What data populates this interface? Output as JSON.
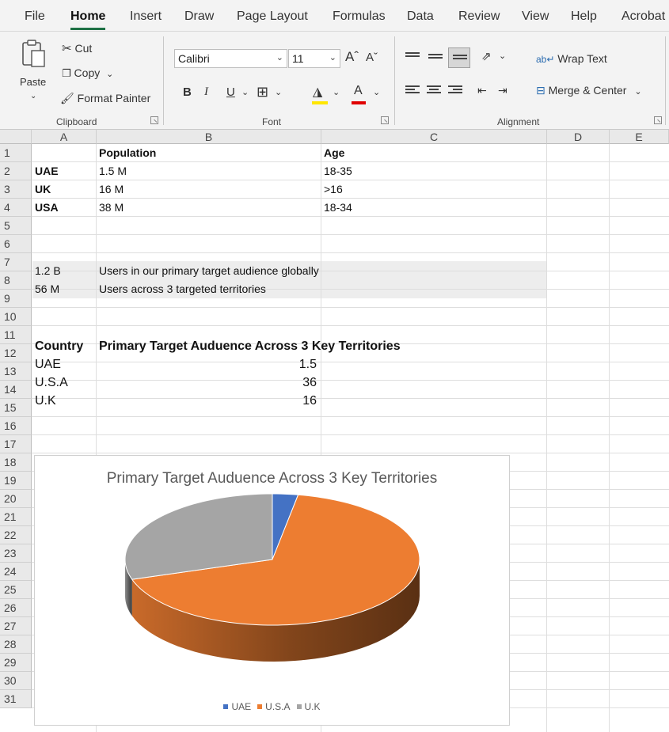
{
  "ribbon": {
    "tabs": [
      "File",
      "Home",
      "Insert",
      "Draw",
      "Page Layout",
      "Formulas",
      "Data",
      "Review",
      "View",
      "Help",
      "Acrobat"
    ],
    "active_tab": "Home",
    "clipboard": {
      "paste": "Paste",
      "cut": "Cut",
      "copy": "Copy",
      "format_painter": "Format Painter",
      "label": "Clipboard"
    },
    "font": {
      "family": "Calibri",
      "size": "11",
      "bold": "B",
      "italic": "I",
      "underline": "U",
      "label": "Font",
      "highlight_color": "#ffe600",
      "font_color": "#e00000"
    },
    "alignment": {
      "wrap_text": "Wrap Text",
      "merge_center": "Merge & Center",
      "label": "Alignment"
    }
  },
  "sheet": {
    "columns": [
      "A",
      "B",
      "C",
      "D",
      "E"
    ],
    "rows": [
      "1",
      "2",
      "3",
      "4",
      "5",
      "6",
      "7",
      "8",
      "9",
      "10",
      "11",
      "12",
      "13",
      "14",
      "15",
      "16",
      "17",
      "18",
      "19",
      "20",
      "21",
      "22",
      "23",
      "24",
      "25",
      "26",
      "27",
      "28",
      "29",
      "30",
      "31"
    ],
    "cells": {
      "B1": "Population",
      "C1": "Age",
      "A2": "UAE",
      "B2": "1.5 M",
      "C2": "18-35",
      "A3": "UK",
      "B3": "16 M",
      "C3": ">16",
      "A4": "USA",
      "B4": "38 M",
      "C4": "18-34",
      "A7": "1.2 B",
      "B7": "Users in our primary target audience globally",
      "A8": "56 M",
      "B8": "Users across 3 targeted territories",
      "A11": "Country",
      "B11": "Primary Target Auduence Across 3 Key Territories",
      "A12": "UAE",
      "B12": "1.5",
      "A13": "U.S.A",
      "B13": "36",
      "A14": "U.K",
      "B14": "16"
    }
  },
  "chart_data": {
    "type": "pie",
    "title": "Primary Target Auduence Across 3 Key Territories",
    "categories": [
      "UAE",
      "U.S.A",
      "U.K"
    ],
    "values": [
      1.5,
      36,
      16
    ],
    "colors": [
      "#4472c4",
      "#ed7d31",
      "#a5a5a5"
    ],
    "legend_position": "bottom",
    "style": "3d"
  }
}
